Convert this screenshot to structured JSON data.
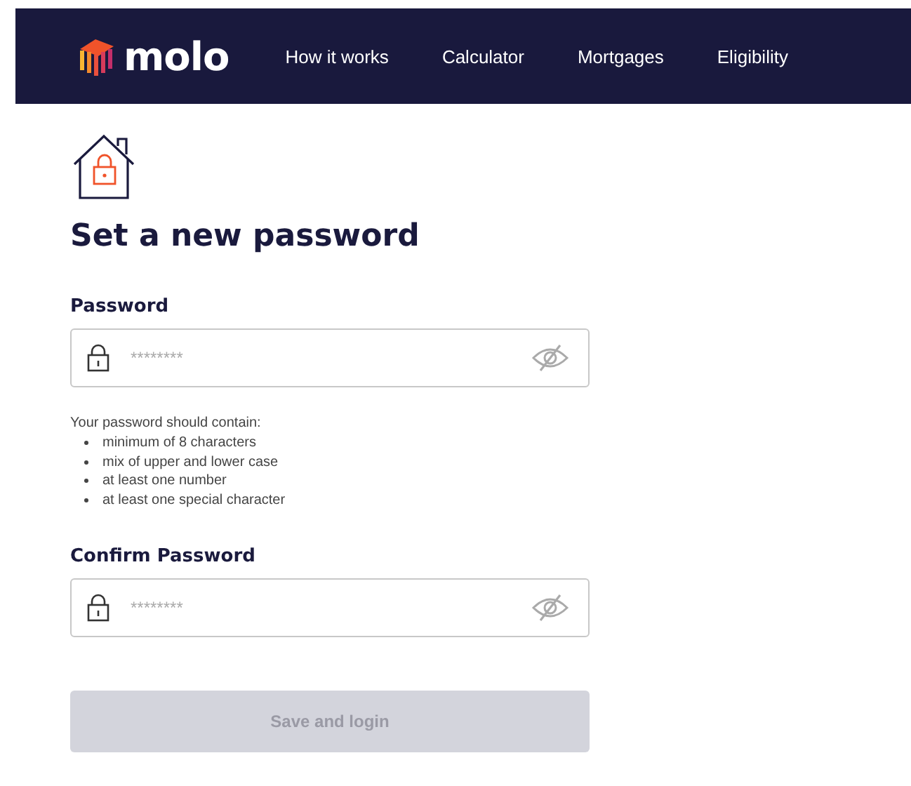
{
  "header": {
    "logo": "molo",
    "nav": [
      "How it works",
      "Calculator",
      "Mortgages",
      "Eligibility"
    ]
  },
  "title": "Set a new password",
  "fields": [
    {
      "label": "Password",
      "placeholder": "********"
    },
    {
      "label": "Confirm Password",
      "placeholder": "********"
    }
  ],
  "hint": {
    "intro": "Your password should contain:",
    "items": [
      "minimum of 8 characters",
      "mix of upper and lower case",
      "at least one number",
      "at least one special character"
    ]
  },
  "submit": {
    "label": "Save and login",
    "disabled": true
  }
}
